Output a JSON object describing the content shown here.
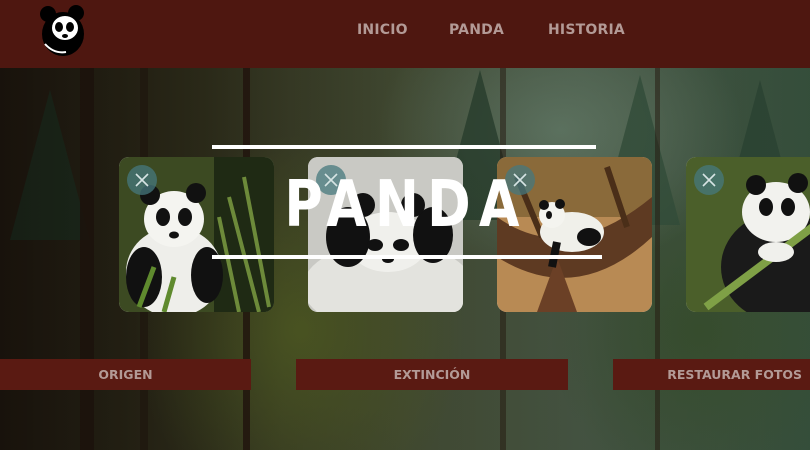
{
  "header": {
    "nav": [
      {
        "label": "INICIO"
      },
      {
        "label": "PANDA"
      },
      {
        "label": "HISTORIA"
      }
    ]
  },
  "hero": {
    "title": "PANDA"
  },
  "gallery": {
    "cards": [
      {
        "close_icon": "close-icon"
      },
      {
        "close_icon": "close-icon"
      },
      {
        "close_icon": "close-icon"
      },
      {
        "close_icon": "close-icon"
      }
    ]
  },
  "actions": {
    "origen": "ORIGEN",
    "extincion": "EXTINCIÓN",
    "restaurar": "RESTAURAR FOTOS"
  },
  "colors": {
    "header_bg": "#4e1710",
    "button_bg": "#5a1a12",
    "nav_text": "#b39a96",
    "close_button": "#46787d"
  }
}
